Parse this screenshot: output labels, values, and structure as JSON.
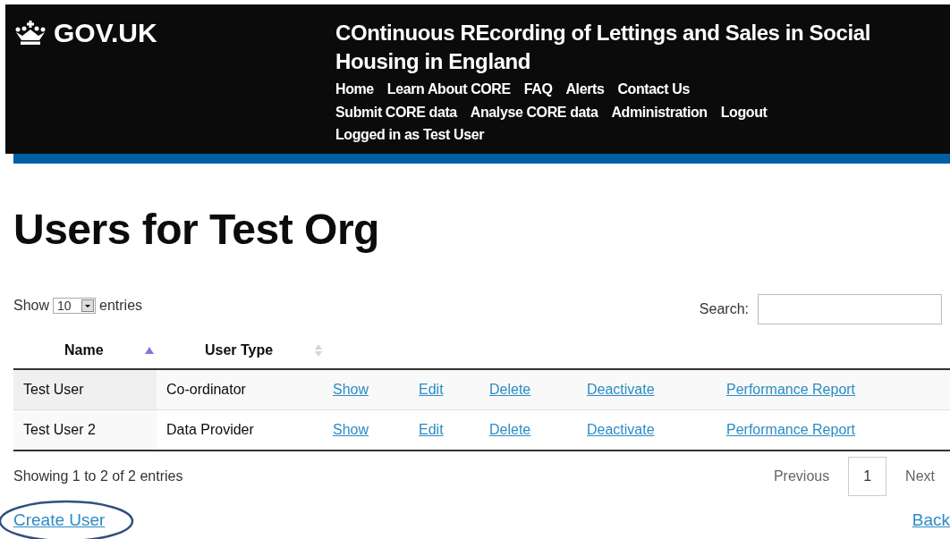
{
  "header": {
    "logo": "GOV.UK",
    "service_title": "COntinuous REcording of Lettings and Sales in Social Housing in England",
    "nav": [
      "Home",
      "Learn About CORE",
      "FAQ",
      "Alerts",
      "Contact Us",
      "Submit CORE data",
      "Analyse CORE data",
      "Administration",
      "Logout"
    ],
    "logged_in": "Logged in as Test User"
  },
  "heading": "Users for Test Org",
  "length_menu": {
    "prefix": "Show",
    "value": "10",
    "suffix": "entries"
  },
  "search": {
    "label": "Search:"
  },
  "table": {
    "columns": [
      {
        "label": "Name",
        "sorted": true
      },
      {
        "label": "User Type",
        "sorted": false
      }
    ],
    "rows": [
      {
        "name": "Test User",
        "type": "Co-ordinator",
        "actions": [
          "Show",
          "Edit",
          "Delete",
          "Deactivate",
          "Performance Report"
        ]
      },
      {
        "name": "Test User 2",
        "type": "Data Provider",
        "actions": [
          "Show",
          "Edit",
          "Delete",
          "Deactivate",
          "Performance Report"
        ]
      }
    ]
  },
  "info": "Showing 1 to 2 of 2 entries",
  "pagination": [
    {
      "label": "Previous",
      "kind": "prev",
      "disabled": true,
      "selected": false
    },
    {
      "label": "1",
      "kind": "page",
      "disabled": false,
      "selected": true
    },
    {
      "label": "Next",
      "kind": "next",
      "disabled": true,
      "selected": false
    }
  ],
  "create_link": {
    "label": "Create User",
    "highlighted": true
  },
  "back_link": "Back"
}
